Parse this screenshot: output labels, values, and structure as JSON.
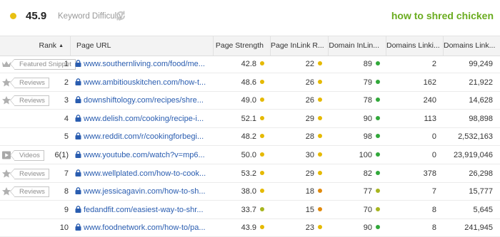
{
  "keyword_difficulty": {
    "score": "45.9",
    "label": "Keyword Difficulty",
    "dot_color": "#e8c012"
  },
  "keyword": {
    "text": "how to shred chicken",
    "color": "#6aac1f"
  },
  "colors": {
    "yellow": "#e5b900",
    "orange": "#e18a0c",
    "green": "#31a83a",
    "olive": "#a7b51e",
    "link": "#2a5db0"
  },
  "columns": {
    "rank": "Rank",
    "page_url": "Page URL",
    "page_strength": "Page Strength",
    "page_inlink": "Page InLink R...",
    "domain_inlink": "Domain InLin...",
    "domains_linking_page": "Domains Linki...",
    "domains_linking_domain": "Domains Link..."
  },
  "rows": [
    {
      "badge": "crown-icon",
      "tag": "Featured Snippet",
      "rank": "1",
      "secure": true,
      "url": "www.southernliving.com/food/me...",
      "ps": "42.8",
      "ps_c": "#e5b900",
      "pir": "22",
      "pir_c": "#e5b900",
      "dir": "89",
      "dir_c": "#31a83a",
      "dlp": "2",
      "dld": "99,249"
    },
    {
      "badge": "star-icon",
      "tag": "Reviews",
      "rank": "2",
      "secure": true,
      "url": "www.ambitiouskitchen.com/how-t...",
      "ps": "48.6",
      "ps_c": "#e5b900",
      "pir": "26",
      "pir_c": "#e5b900",
      "dir": "79",
      "dir_c": "#31a83a",
      "dlp": "162",
      "dld": "21,922"
    },
    {
      "badge": "star-icon",
      "tag": "Reviews",
      "rank": "3",
      "secure": true,
      "url": "downshiftology.com/recipes/shre...",
      "ps": "49.0",
      "ps_c": "#e5b900",
      "pir": "26",
      "pir_c": "#e5b900",
      "dir": "78",
      "dir_c": "#31a83a",
      "dlp": "240",
      "dld": "14,628"
    },
    {
      "badge": "",
      "tag": "",
      "rank": "4",
      "secure": true,
      "url": "www.delish.com/cooking/recipe-i...",
      "ps": "52.1",
      "ps_c": "#e5b900",
      "pir": "29",
      "pir_c": "#e5b900",
      "dir": "90",
      "dir_c": "#31a83a",
      "dlp": "113",
      "dld": "98,898"
    },
    {
      "badge": "",
      "tag": "",
      "rank": "5",
      "secure": true,
      "url": "www.reddit.com/r/cookingforbegi...",
      "ps": "48.2",
      "ps_c": "#e5b900",
      "pir": "28",
      "pir_c": "#e5b900",
      "dir": "98",
      "dir_c": "#31a83a",
      "dlp": "0",
      "dld": "2,532,163"
    },
    {
      "badge": "video-icon",
      "tag": "Videos",
      "rank": "6(1)",
      "secure": true,
      "url": "www.youtube.com/watch?v=mp6...",
      "ps": "50.0",
      "ps_c": "#e5b900",
      "pir": "30",
      "pir_c": "#e5b900",
      "dir": "100",
      "dir_c": "#31a83a",
      "dlp": "0",
      "dld": "23,919,046"
    },
    {
      "badge": "star-icon",
      "tag": "Reviews",
      "rank": "7",
      "secure": true,
      "url": "www.wellplated.com/how-to-cook...",
      "ps": "53.2",
      "ps_c": "#e5b900",
      "pir": "29",
      "pir_c": "#e5b900",
      "dir": "82",
      "dir_c": "#31a83a",
      "dlp": "378",
      "dld": "26,298"
    },
    {
      "badge": "star-icon",
      "tag": "Reviews",
      "rank": "8",
      "secure": true,
      "url": "www.jessicagavin.com/how-to-sh...",
      "ps": "38.0",
      "ps_c": "#e5b900",
      "pir": "18",
      "pir_c": "#e18a0c",
      "dir": "77",
      "dir_c": "#a7b51e",
      "dlp": "7",
      "dld": "15,777"
    },
    {
      "badge": "",
      "tag": "",
      "rank": "9",
      "secure": true,
      "url": "fedandfit.com/easiest-way-to-shr...",
      "ps": "33.7",
      "ps_c": "#a7b51e",
      "pir": "15",
      "pir_c": "#e18a0c",
      "dir": "70",
      "dir_c": "#a7b51e",
      "dlp": "8",
      "dld": "5,645"
    },
    {
      "badge": "",
      "tag": "",
      "rank": "10",
      "secure": true,
      "url": "www.foodnetwork.com/how-to/pa...",
      "ps": "43.9",
      "ps_c": "#e5b900",
      "pir": "23",
      "pir_c": "#e5b900",
      "dir": "90",
      "dir_c": "#31a83a",
      "dlp": "8",
      "dld": "241,945"
    }
  ]
}
